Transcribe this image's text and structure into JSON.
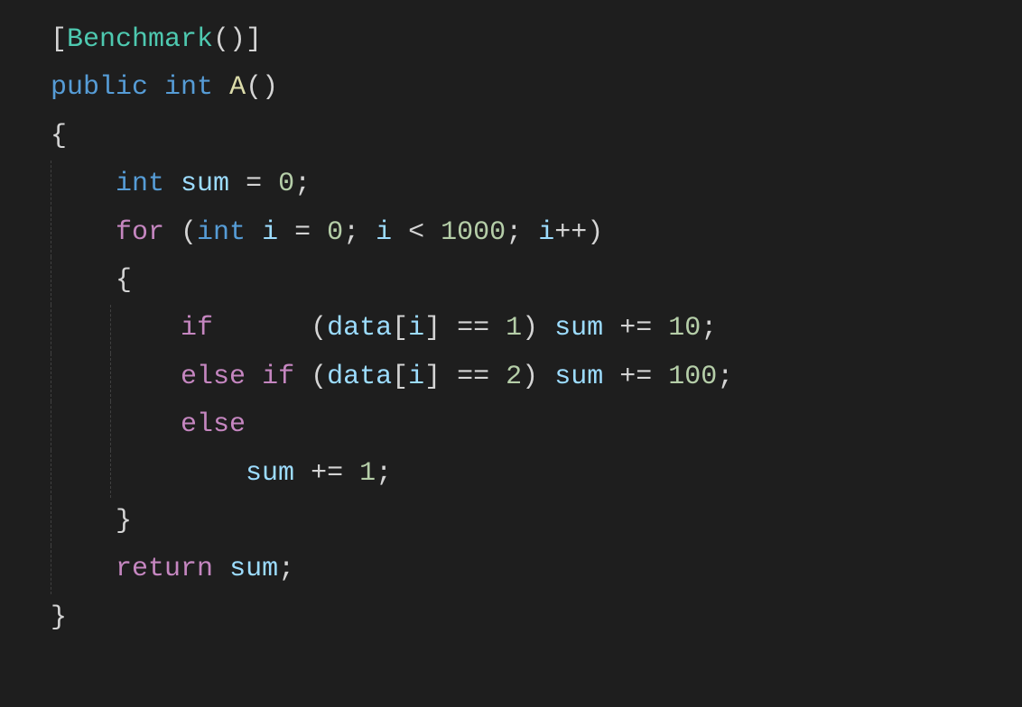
{
  "code": {
    "lines": [
      {
        "tokens": [
          {
            "t": "[",
            "c": "punc"
          },
          {
            "t": "Benchmark",
            "c": "type"
          },
          {
            "t": "()]",
            "c": "punc"
          }
        ],
        "guides": []
      },
      {
        "tokens": [
          {
            "t": "public",
            "c": "keyword"
          },
          {
            "t": " ",
            "c": "punc"
          },
          {
            "t": "int",
            "c": "keyword"
          },
          {
            "t": " ",
            "c": "punc"
          },
          {
            "t": "A",
            "c": "method"
          },
          {
            "t": "()",
            "c": "punc"
          }
        ],
        "guides": []
      },
      {
        "tokens": [
          {
            "t": "{",
            "c": "punc"
          }
        ],
        "guides": []
      },
      {
        "tokens": [
          {
            "t": "    ",
            "c": "punc"
          },
          {
            "t": "int",
            "c": "keyword"
          },
          {
            "t": " ",
            "c": "punc"
          },
          {
            "t": "sum",
            "c": "var"
          },
          {
            "t": " = ",
            "c": "punc"
          },
          {
            "t": "0",
            "c": "num"
          },
          {
            "t": ";",
            "c": "punc"
          }
        ],
        "guides": [
          0
        ]
      },
      {
        "tokens": [
          {
            "t": "    ",
            "c": "punc"
          },
          {
            "t": "for",
            "c": "flow"
          },
          {
            "t": " (",
            "c": "punc"
          },
          {
            "t": "int",
            "c": "keyword"
          },
          {
            "t": " ",
            "c": "punc"
          },
          {
            "t": "i",
            "c": "var"
          },
          {
            "t": " = ",
            "c": "punc"
          },
          {
            "t": "0",
            "c": "num"
          },
          {
            "t": "; ",
            "c": "punc"
          },
          {
            "t": "i",
            "c": "var"
          },
          {
            "t": " < ",
            "c": "punc"
          },
          {
            "t": "1000",
            "c": "num"
          },
          {
            "t": "; ",
            "c": "punc"
          },
          {
            "t": "i",
            "c": "var"
          },
          {
            "t": "++)",
            "c": "punc"
          }
        ],
        "guides": [
          0
        ]
      },
      {
        "tokens": [
          {
            "t": "    {",
            "c": "punc"
          }
        ],
        "guides": [
          0
        ]
      },
      {
        "tokens": [
          {
            "t": "        ",
            "c": "punc"
          },
          {
            "t": "if",
            "c": "flow"
          },
          {
            "t": "      (",
            "c": "punc"
          },
          {
            "t": "data",
            "c": "var"
          },
          {
            "t": "[",
            "c": "punc"
          },
          {
            "t": "i",
            "c": "var"
          },
          {
            "t": "] == ",
            "c": "punc"
          },
          {
            "t": "1",
            "c": "num"
          },
          {
            "t": ") ",
            "c": "punc"
          },
          {
            "t": "sum",
            "c": "var"
          },
          {
            "t": " += ",
            "c": "punc"
          },
          {
            "t": "10",
            "c": "num"
          },
          {
            "t": ";",
            "c": "punc"
          }
        ],
        "guides": [
          0,
          1
        ]
      },
      {
        "tokens": [
          {
            "t": "        ",
            "c": "punc"
          },
          {
            "t": "else",
            "c": "flow"
          },
          {
            "t": " ",
            "c": "punc"
          },
          {
            "t": "if",
            "c": "flow"
          },
          {
            "t": " (",
            "c": "punc"
          },
          {
            "t": "data",
            "c": "var"
          },
          {
            "t": "[",
            "c": "punc"
          },
          {
            "t": "i",
            "c": "var"
          },
          {
            "t": "] == ",
            "c": "punc"
          },
          {
            "t": "2",
            "c": "num"
          },
          {
            "t": ") ",
            "c": "punc"
          },
          {
            "t": "sum",
            "c": "var"
          },
          {
            "t": " += ",
            "c": "punc"
          },
          {
            "t": "100",
            "c": "num"
          },
          {
            "t": ";",
            "c": "punc"
          }
        ],
        "guides": [
          0,
          1
        ]
      },
      {
        "tokens": [
          {
            "t": "        ",
            "c": "punc"
          },
          {
            "t": "else",
            "c": "flow"
          }
        ],
        "guides": [
          0,
          1
        ]
      },
      {
        "tokens": [
          {
            "t": "            ",
            "c": "punc"
          },
          {
            "t": "sum",
            "c": "var"
          },
          {
            "t": " += ",
            "c": "punc"
          },
          {
            "t": "1",
            "c": "num"
          },
          {
            "t": ";",
            "c": "punc"
          }
        ],
        "guides": [
          0,
          1
        ]
      },
      {
        "tokens": [
          {
            "t": "    }",
            "c": "punc"
          }
        ],
        "guides": [
          0
        ]
      },
      {
        "tokens": [
          {
            "t": "    ",
            "c": "punc"
          },
          {
            "t": "return",
            "c": "flow"
          },
          {
            "t": " ",
            "c": "punc"
          },
          {
            "t": "sum",
            "c": "var"
          },
          {
            "t": ";",
            "c": "punc"
          }
        ],
        "guides": [
          0
        ]
      },
      {
        "tokens": [
          {
            "t": "}",
            "c": "punc"
          }
        ],
        "guides": []
      }
    ]
  },
  "colors": {
    "background": "#1e1e1e",
    "default": "#d4d4d4",
    "type": "#4ec9b0",
    "keyword": "#569cd6",
    "method": "#dcdcaa",
    "variable": "#9cdcfe",
    "number": "#b5cea8",
    "flow": "#c586c0",
    "guide": "#404040"
  }
}
